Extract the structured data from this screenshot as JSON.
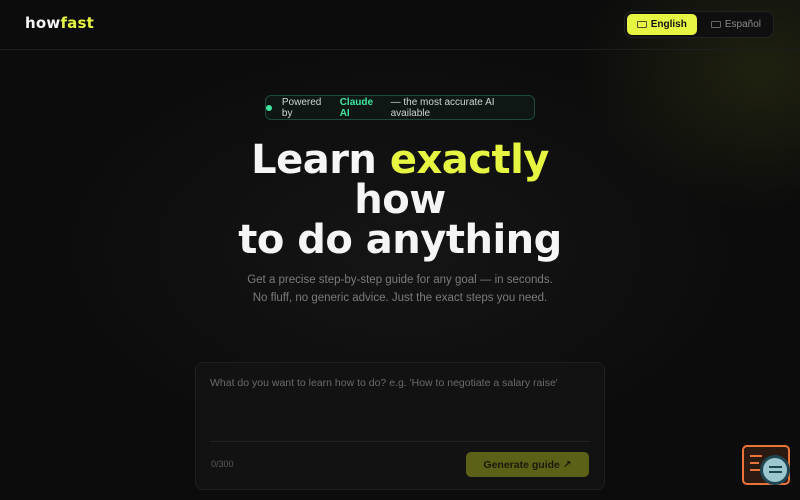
{
  "header": {
    "logo_part1": "how",
    "logo_part2": "fast",
    "languages": [
      {
        "label": "English",
        "active": true
      },
      {
        "label": "Español",
        "active": false
      }
    ]
  },
  "badge": {
    "prefix": "Powered by",
    "brand": "Claude AI",
    "suffix": "— the most accurate AI available"
  },
  "hero": {
    "line1_plain": "Learn ",
    "line1_highlight": "exactly",
    "line2": "how",
    "line3": "to do anything",
    "subtitle": "Get a precise step-by-step guide for any goal — in seconds. No fluff, no generic advice. Just the exact steps you need."
  },
  "input": {
    "placeholder": "What do you want to learn how to do? e.g. 'How to negotiate a salary raise'",
    "value": "",
    "counter": "0/300",
    "button_label": "Generate guide ↗"
  },
  "colors": {
    "accent": "#e6f542",
    "brand_green": "#3ee6a0",
    "background": "#0c0c0c",
    "widget_orange": "#e8743a"
  },
  "icons": {
    "flag": "flag-icon",
    "status_dot": "status-dot-icon",
    "widget": "terminal-search-icon"
  }
}
